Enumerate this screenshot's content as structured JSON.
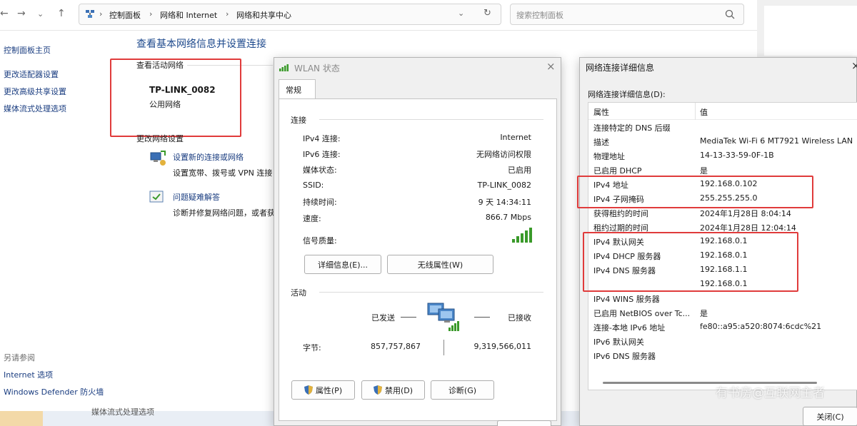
{
  "address_bar": {
    "crumbs": [
      "控制面板",
      "网络和 Internet",
      "网络和共享中心"
    ],
    "search_placeholder": "搜索控制面板"
  },
  "left_nav": {
    "items": [
      "控制面板主页",
      "更改适配器设置",
      "更改高级共享设置",
      "媒体流式处理选项"
    ],
    "see_also_title": "另请参阅",
    "see_also": [
      "Internet 选项",
      "Windows Defender 防火墙"
    ]
  },
  "main": {
    "title": "查看基本网络信息并设置连接",
    "active_networks_label": "查看活动网络",
    "network_name": "TP-LINK_0082",
    "network_type": "公用网络",
    "change_settings_label": "更改网络设置",
    "actions": [
      {
        "title": "设置新的连接或网络",
        "desc": "设置宽带、拨号或 VPN 连接"
      },
      {
        "title": "问题疑难解答",
        "desc": "诊断并修复网络问题，或者获"
      }
    ],
    "bottom_item": "媒体流式处理选项"
  },
  "wlan_dialog": {
    "title": "WLAN 状态",
    "tab": "常规",
    "connection_label": "连接",
    "rows": [
      {
        "label": "IPv4 连接:",
        "value": "Internet"
      },
      {
        "label": "IPv6 连接:",
        "value": "无网络访问权限"
      },
      {
        "label": "媒体状态:",
        "value": "已启用"
      },
      {
        "label": "SSID:",
        "value": "TP-LINK_0082"
      },
      {
        "label": "持续时间:",
        "value": "9 天 14:34:11"
      },
      {
        "label": "速度:",
        "value": "866.7 Mbps"
      }
    ],
    "signal_label": "信号质量:",
    "details_button": "详细信息(E)...",
    "wireless_props_button": "无线属性(W)",
    "activity_label": "活动",
    "sent_label": "已发送",
    "received_label": "已接收",
    "bytes_label": "字节:",
    "bytes_sent": "857,757,867",
    "bytes_received": "9,319,566,011",
    "properties_button": "属性(P)",
    "disable_button": "禁用(D)",
    "diagnose_button": "诊断(G)"
  },
  "details_dialog": {
    "title": "网络连接详细信息",
    "list_label": "网络连接详细信息(D):",
    "col_property": "属性",
    "col_value": "值",
    "rows": [
      {
        "prop": "连接特定的 DNS 后缀",
        "val": ""
      },
      {
        "prop": "描述",
        "val": "MediaTek Wi-Fi 6 MT7921 Wireless LAN"
      },
      {
        "prop": "物理地址",
        "val": "14-13-33-59-0F-1B"
      },
      {
        "prop": "已启用 DHCP",
        "val": "是"
      },
      {
        "prop": "IPv4 地址",
        "val": "192.168.0.102"
      },
      {
        "prop": "IPv4 子网掩码",
        "val": "255.255.255.0"
      },
      {
        "prop": "获得租约的时间",
        "val": "2024年1月28日 8:04:14"
      },
      {
        "prop": "租约过期的时间",
        "val": "2024年1月28日 12:04:14"
      },
      {
        "prop": "IPv4 默认网关",
        "val": "192.168.0.1"
      },
      {
        "prop": "IPv4 DHCP 服务器",
        "val": "192.168.0.1"
      },
      {
        "prop": "IPv4 DNS 服务器",
        "val": "192.168.1.1"
      },
      {
        "prop": "",
        "val": "192.168.0.1"
      },
      {
        "prop": "IPv4 WINS 服务器",
        "val": ""
      },
      {
        "prop": "已启用 NetBIOS over Tc...",
        "val": "是"
      },
      {
        "prop": "连接-本地 IPv6 地址",
        "val": "fe80::a95:a520:8074:6cdc%21"
      },
      {
        "prop": "IPv6 默认网关",
        "val": ""
      },
      {
        "prop": "IPv6 DNS 服务器",
        "val": ""
      }
    ],
    "close_button": "关闭(C)"
  },
  "watermark": "有书房@互联网主者",
  "colors": {
    "highlight_red": "#e03b3b",
    "link_blue": "#1a3d80",
    "title_blue": "#1e4a8d",
    "signal_green": "#3a9a2a"
  }
}
